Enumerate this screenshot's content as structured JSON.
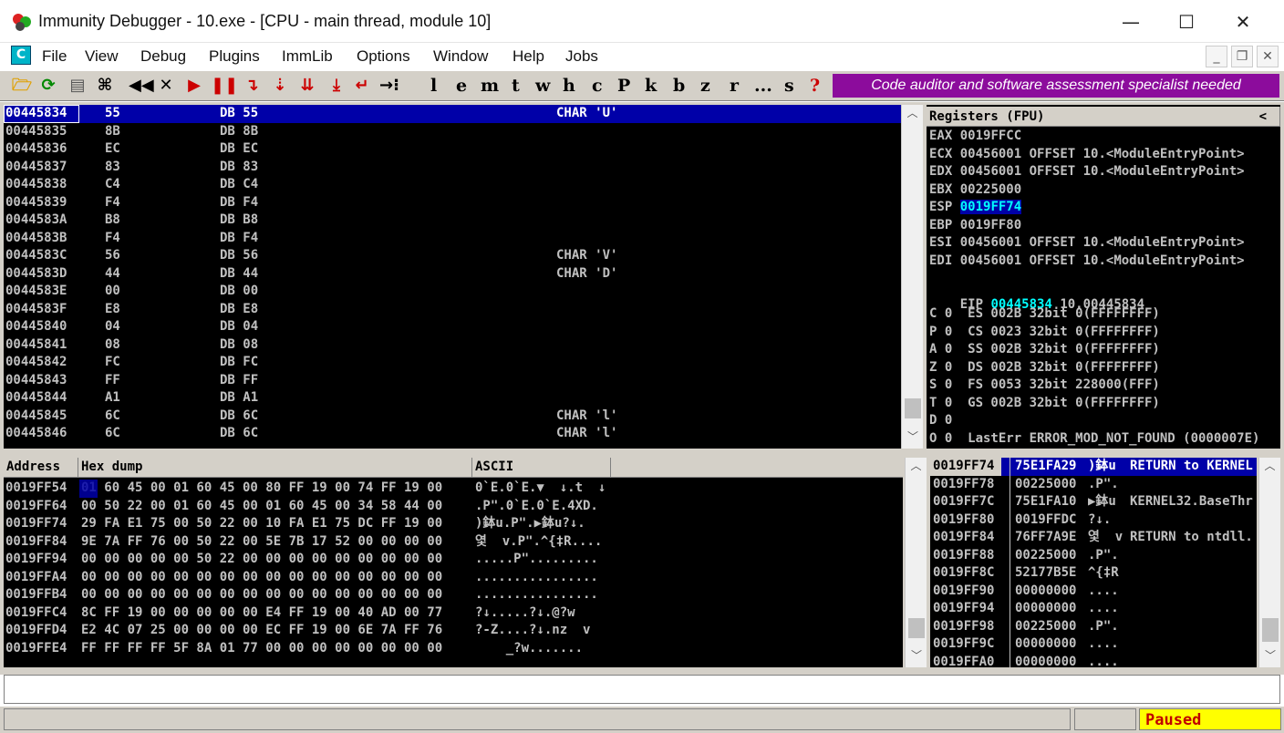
{
  "window": {
    "title": "Immunity Debugger - 10.exe - [CPU - main thread, module 10]",
    "controls": {
      "minimize": "—",
      "maximize": "☐",
      "close": "✕"
    }
  },
  "menu": {
    "icon_letter": "C",
    "items": [
      "File",
      "View",
      "Debug",
      "Plugins",
      "ImmLib",
      "Options",
      "Window",
      "Help",
      "Jobs"
    ]
  },
  "toolbar": {
    "letters": [
      "l",
      "e",
      "m",
      "t",
      "w",
      "h",
      "c",
      "P",
      "k",
      "b",
      "z",
      "r",
      "...",
      "s",
      "?"
    ],
    "banner": "Code auditor and software assessment specialist needed"
  },
  "disasm": {
    "selected_row": {
      "addr": "00445834",
      "hex": "55",
      "cmd": "DB 55",
      "comment": "CHAR 'U'"
    },
    "rows": [
      {
        "addr": "00445835",
        "hex": "8B",
        "cmd": "DB 8B",
        "comment": ""
      },
      {
        "addr": "00445836",
        "hex": "EC",
        "cmd": "DB EC",
        "comment": ""
      },
      {
        "addr": "00445837",
        "hex": "83",
        "cmd": "DB 83",
        "comment": ""
      },
      {
        "addr": "00445838",
        "hex": "C4",
        "cmd": "DB C4",
        "comment": ""
      },
      {
        "addr": "00445839",
        "hex": "F4",
        "cmd": "DB F4",
        "comment": ""
      },
      {
        "addr": "0044583A",
        "hex": "B8",
        "cmd": "DB B8",
        "comment": ""
      },
      {
        "addr": "0044583B",
        "hex": "F4",
        "cmd": "DB F4",
        "comment": ""
      },
      {
        "addr": "0044583C",
        "hex": "56",
        "cmd": "DB 56",
        "comment": "CHAR 'V'"
      },
      {
        "addr": "0044583D",
        "hex": "44",
        "cmd": "DB 44",
        "comment": "CHAR 'D'"
      },
      {
        "addr": "0044583E",
        "hex": "00",
        "cmd": "DB 00",
        "comment": ""
      },
      {
        "addr": "0044583F",
        "hex": "E8",
        "cmd": "DB E8",
        "comment": ""
      },
      {
        "addr": "00445840",
        "hex": "04",
        "cmd": "DB 04",
        "comment": ""
      },
      {
        "addr": "00445841",
        "hex": "08",
        "cmd": "DB 08",
        "comment": ""
      },
      {
        "addr": "00445842",
        "hex": "FC",
        "cmd": "DB FC",
        "comment": ""
      },
      {
        "addr": "00445843",
        "hex": "FF",
        "cmd": "DB FF",
        "comment": ""
      },
      {
        "addr": "00445844",
        "hex": "A1",
        "cmd": "DB A1",
        "comment": ""
      },
      {
        "addr": "00445845",
        "hex": "6C",
        "cmd": "DB 6C",
        "comment": "CHAR 'l'"
      },
      {
        "addr": "00445846",
        "hex": "6C",
        "cmd": "DB 6C",
        "comment": "CHAR 'l'"
      }
    ]
  },
  "registers": {
    "header": "Registers (FPU)",
    "collapse": "<",
    "general": [
      {
        "name": "EAX",
        "value": "0019FFCC",
        "note": "",
        "highlight": false
      },
      {
        "name": "ECX",
        "value": "00456001",
        "note": "OFFSET 10.<ModuleEntryPoint>",
        "highlight": false
      },
      {
        "name": "EDX",
        "value": "00456001",
        "note": "OFFSET 10.<ModuleEntryPoint>",
        "highlight": false
      },
      {
        "name": "EBX",
        "value": "00225000",
        "note": "",
        "highlight": false
      },
      {
        "name": "ESP",
        "value": "0019FF74",
        "note": "",
        "highlight": true
      },
      {
        "name": "EBP",
        "value": "0019FF80",
        "note": "",
        "highlight": false
      },
      {
        "name": "ESI",
        "value": "00456001",
        "note": "OFFSET 10.<ModuleEntryPoint>",
        "highlight": false
      },
      {
        "name": "EDI",
        "value": "00456001",
        "note": "OFFSET 10.<ModuleEntryPoint>",
        "highlight": false
      }
    ],
    "eip": {
      "name": "EIP",
      "value": "00445834",
      "note": "10.00445834"
    },
    "flags": [
      "C 0  ES 002B 32bit 0(FFFFFFFF)",
      "P 0  CS 0023 32bit 0(FFFFFFFF)",
      "A 0  SS 002B 32bit 0(FFFFFFFF)",
      "Z 0  DS 002B 32bit 0(FFFFFFFF)",
      "S 0  FS 0053 32bit 228000(FFF)",
      "T 0  GS 002B 32bit 0(FFFFFFFF)",
      "D 0",
      "O 0  LastErr ERROR_MOD_NOT_FOUND (0000007E)"
    ]
  },
  "dump": {
    "headers": {
      "address": "Address",
      "hex": "Hex dump",
      "ascii": "ASCII"
    },
    "rows": [
      {
        "addr": "0019FF54",
        "hex": "01 60 45 00 01 60 45 00 80 FF 19 00 74 FF 19 00",
        "ascii": "0`E.0`E.▼  ↓.t  ↓"
      },
      {
        "addr": "0019FF64",
        "hex": "00 50 22 00 01 60 45 00 01 60 45 00 34 58 44 00",
        "ascii": ".P\".0`E.0`E.4XD."
      },
      {
        "addr": "0019FF74",
        "hex": "29 FA E1 75 00 50 22 00 10 FA E1 75 DC FF 19 00",
        "ascii": ")鉢u.P\".▶鉢u?↓."
      },
      {
        "addr": "0019FF84",
        "hex": "9E 7A FF 76 00 50 22 00 5E 7B 17 52 00 00 00 00",
        "ascii": "옃  v.P\".^{‡R...."
      },
      {
        "addr": "0019FF94",
        "hex": "00 00 00 00 00 50 22 00 00 00 00 00 00 00 00 00",
        "ascii": ".....P\"........."
      },
      {
        "addr": "0019FFA4",
        "hex": "00 00 00 00 00 00 00 00 00 00 00 00 00 00 00 00",
        "ascii": "................"
      },
      {
        "addr": "0019FFB4",
        "hex": "00 00 00 00 00 00 00 00 00 00 00 00 00 00 00 00",
        "ascii": "................"
      },
      {
        "addr": "0019FFC4",
        "hex": "8C FF 19 00 00 00 00 00 E4 FF 19 00 40 AD 00 77",
        "ascii": "?↓.....?↓.@?w"
      },
      {
        "addr": "0019FFD4",
        "hex": "E2 4C 07 25 00 00 00 00 EC FF 19 00 6E 7A FF 76",
        "ascii": "?-Z....?↓.nz  v"
      },
      {
        "addr": "0019FFE4",
        "hex": "FF FF FF FF 5F 8A 01 77 00 00 00 00 00 00 00 00",
        "ascii": "    _?w......."
      }
    ]
  },
  "stack": {
    "selected_row": {
      "addr": "0019FF74",
      "value": "75E1FA29",
      "ascii": ")鉢u",
      "comment": "RETURN to KERNEL"
    },
    "rows": [
      {
        "addr": "0019FF78",
        "value": "00225000",
        "ascii": ".P\".",
        "comment": ""
      },
      {
        "addr": "0019FF7C",
        "value": "75E1FA10",
        "ascii": "▶鉢u",
        "comment": "KERNEL32.BaseThr"
      },
      {
        "addr": "0019FF80",
        "value": "0019FFDC",
        "ascii": "?↓.",
        "comment": ""
      },
      {
        "addr": "0019FF84",
        "value": "76FF7A9E",
        "ascii": "옃  v",
        "comment": "RETURN to ntdll."
      },
      {
        "addr": "0019FF88",
        "value": "00225000",
        "ascii": ".P\".",
        "comment": ""
      },
      {
        "addr": "0019FF8C",
        "value": "52177B5E",
        "ascii": "^{‡R",
        "comment": ""
      },
      {
        "addr": "0019FF90",
        "value": "00000000",
        "ascii": "....",
        "comment": ""
      },
      {
        "addr": "0019FF94",
        "value": "00000000",
        "ascii": "....",
        "comment": ""
      },
      {
        "addr": "0019FF98",
        "value": "00225000",
        "ascii": ".P\".",
        "comment": ""
      },
      {
        "addr": "0019FF9C",
        "value": "00000000",
        "ascii": "....",
        "comment": ""
      },
      {
        "addr": "0019FFA0",
        "value": "00000000",
        "ascii": "....",
        "comment": ""
      }
    ]
  },
  "status": {
    "state": "Paused"
  },
  "colors": {
    "text_gray": "#c0c0c0",
    "highlight_cyan": "#00ffff",
    "selection_blue": "#0000a8",
    "banner_purple": "#8c0c9c",
    "status_yellow": "#ffff00"
  }
}
